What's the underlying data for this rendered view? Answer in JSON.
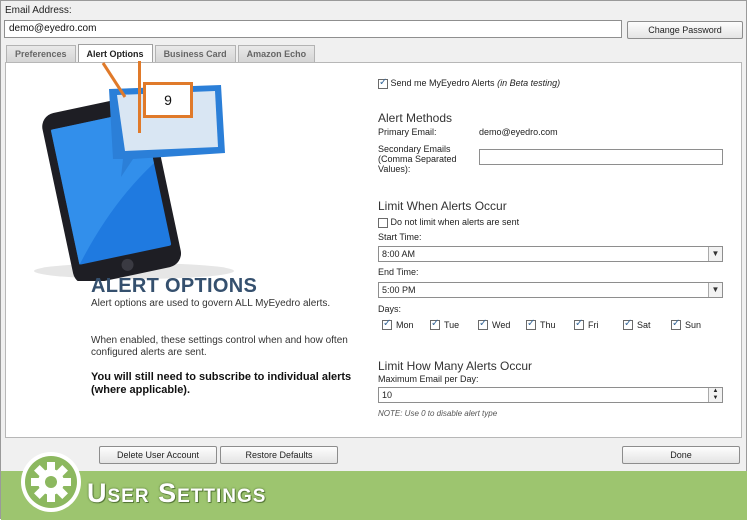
{
  "header": {
    "email_label": "Email Address:",
    "email_value": "demo@eyedro.com",
    "change_password": "Change Password"
  },
  "tabs": [
    {
      "label": "Preferences",
      "active": false
    },
    {
      "label": "Alert Options",
      "active": true
    },
    {
      "label": "Business Card",
      "active": false
    },
    {
      "label": "Amazon Echo",
      "active": false
    }
  ],
  "callout": {
    "number": "9"
  },
  "left": {
    "title": "ALERT OPTIONS",
    "p1": "Alert options are used to govern ALL MyEyedro alerts.",
    "p2": "When enabled, these settings control when and how often configured alerts are sent.",
    "p3": "You will still need to subscribe to individual alerts (where applicable)."
  },
  "right": {
    "send_alerts": "Send me MyEyedro Alerts",
    "send_alerts_note": "(in Beta testing)",
    "methods_title": "Alert Methods",
    "primary_label": "Primary Email:",
    "primary_value": "demo@eyedro.com",
    "secondary_label": "Secondary Emails (Comma Separated Values):",
    "limit_when_title": "Limit When Alerts Occur",
    "no_limit_label": "Do not limit when alerts are sent",
    "start_label": "Start Time:",
    "start_value": "8:00 AM",
    "end_label": "End Time:",
    "end_value": "5:00 PM",
    "days_label": "Days:",
    "days": [
      "Mon",
      "Tue",
      "Wed",
      "Thu",
      "Fri",
      "Sat",
      "Sun"
    ],
    "limit_many_title": "Limit How Many Alerts Occur",
    "max_label": "Maximum Email per Day:",
    "max_value": "10",
    "note": "NOTE: Use 0 to disable alert type"
  },
  "footer": {
    "delete": "Delete User Account",
    "restore": "Restore Defaults",
    "done": "Done",
    "banner": "User Settings"
  },
  "colors": {
    "accent": "#e07a2a",
    "banner": "#9dc56f",
    "title": "#35506e"
  }
}
